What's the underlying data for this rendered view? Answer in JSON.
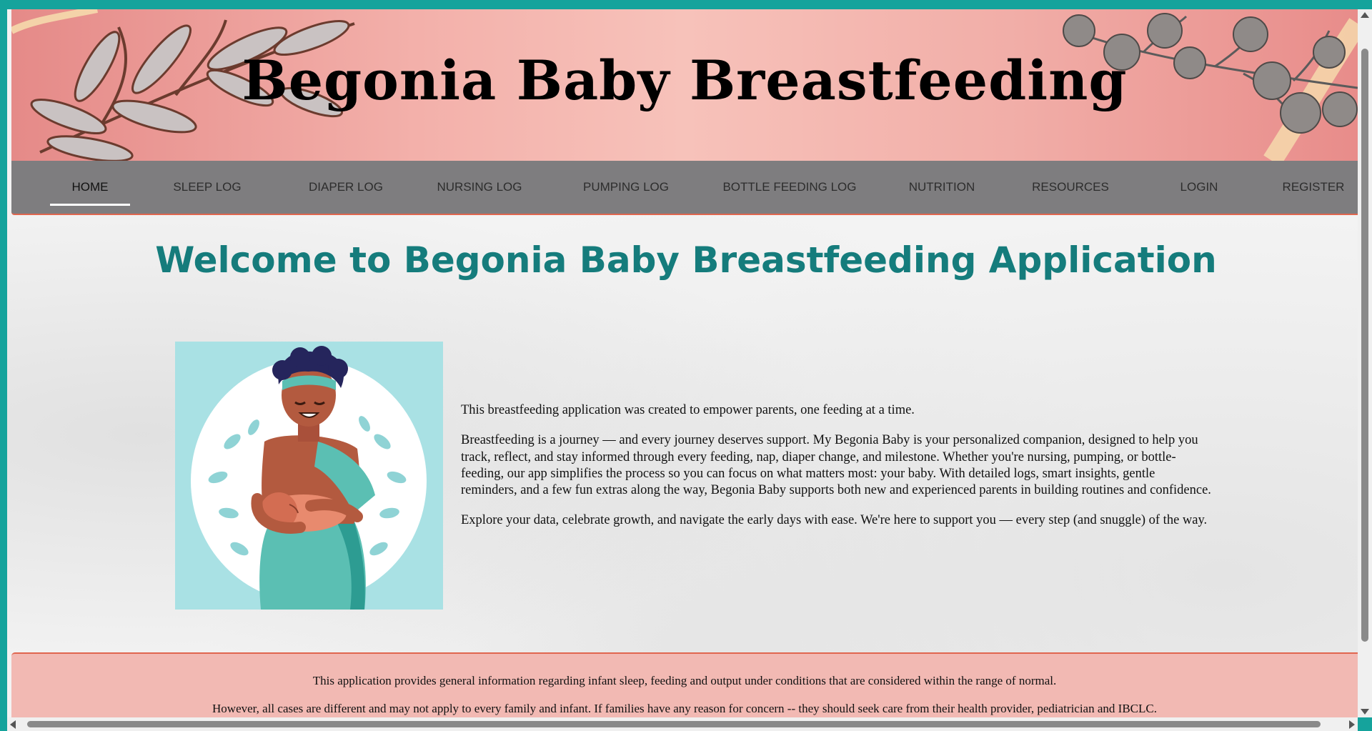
{
  "header": {
    "title": "Begonia Baby Breastfeeding"
  },
  "nav": {
    "items": [
      {
        "label": "HOME",
        "active": true
      },
      {
        "label": "SLEEP LOG"
      },
      {
        "label": "DIAPER LOG"
      },
      {
        "label": "NURSING LOG"
      },
      {
        "label": "PUMPING LOG"
      },
      {
        "label": "BOTTLE FEEDING LOG"
      },
      {
        "label": "NUTRITION"
      },
      {
        "label": "RESOURCES"
      },
      {
        "label": "LOGIN"
      },
      {
        "label": "REGISTER"
      }
    ]
  },
  "main": {
    "welcome": "Welcome to Begonia Baby Breastfeeding Application",
    "paragraphs": [
      "This breastfeeding application was created to empower parents, one feeding at a time.",
      "Breastfeeding is a journey — and every journey deserves support. My Begonia Baby is your personalized companion, designed to help you track, reflect, and stay informed through every feeding, nap, diaper change, and milestone. Whether you're nursing, pumping, or bottle-feeding, our app simplifies the process so you can focus on what matters most: your baby. With detailed logs, smart insights, gentle reminders, and a few fun extras along the way, Begonia Baby supports both new and experienced parents in building routines and confidence.",
      "Explore your data, celebrate growth, and navigate the early days with ease. We're here to support you — every step (and snuggle) of the way."
    ]
  },
  "footer": {
    "line1": "This application provides general information regarding infant sleep, feeding and output under conditions that are considered within the range of normal.",
    "line2": "However, all cases are different and may not apply to every family and infant. If families have any reason for concern -- they should seek care from their health provider, pediatrician and IBCLC."
  },
  "colors": {
    "accent": "#157c7c",
    "header_pink": "#f3b0aa",
    "nav_gray": "#7e7d7f",
    "border_orange": "#e0664f",
    "frame_teal": "#15a39c"
  }
}
